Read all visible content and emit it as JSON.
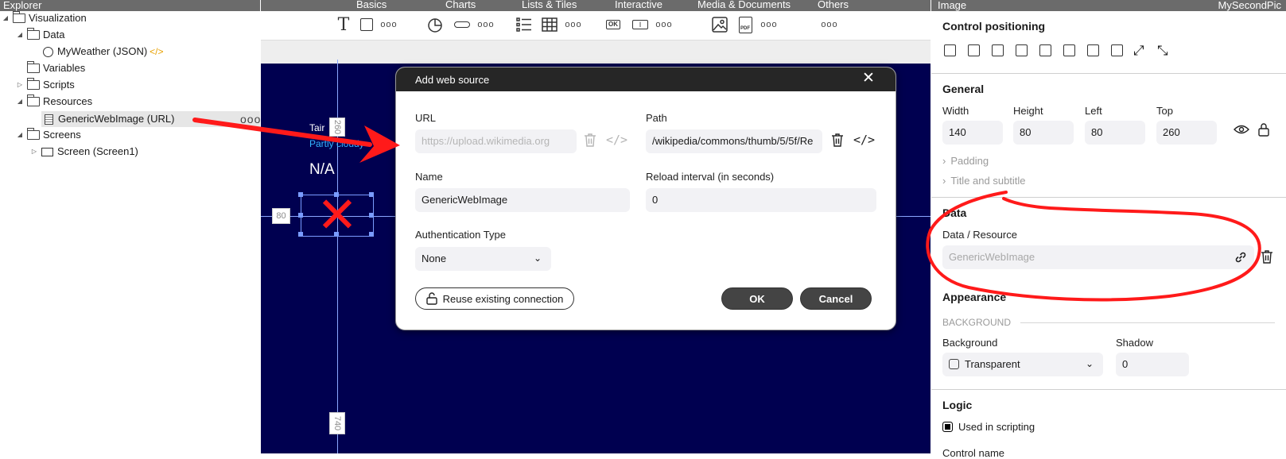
{
  "explorer": {
    "title": "Explorer",
    "items": [
      {
        "label": "Visualization"
      },
      {
        "label": "Data"
      },
      {
        "label": "MyWeather (JSON)",
        "badge": "</>"
      },
      {
        "label": "Variables"
      },
      {
        "label": "Scripts"
      },
      {
        "label": "Resources"
      },
      {
        "label": "GenericWebImage (URL)",
        "more": "ooo"
      },
      {
        "label": "Screens"
      },
      {
        "label": "Screen (Screen1)"
      }
    ]
  },
  "toolbar": {
    "categories": [
      "Basics",
      "Charts",
      "Lists & Tiles",
      "Interactive",
      "Media & Documents",
      "Others"
    ],
    "more": "ooo",
    "text_tool": "T",
    "ok_badge": "OK",
    "input_badge": "I",
    "pdf_badge": "PDF"
  },
  "canvas": {
    "city_text": "Tair",
    "condition_text": "Partly cloudy",
    "temp_text": "N/A",
    "dim_left": "80",
    "dim_top": "260",
    "dim_bottom": "740",
    "image_placeholder": "✕"
  },
  "dialog": {
    "title": "Add web source",
    "url_label": "URL",
    "url_placeholder": "https://upload.wikimedia.org",
    "path_label": "Path",
    "path_value": "/wikipedia/commons/thumb/5/5f/Re",
    "name_label": "Name",
    "name_value": "GenericWebImage",
    "reload_label": "Reload interval (in seconds)",
    "reload_value": "0",
    "auth_label": "Authentication Type",
    "auth_value": "None",
    "reuse_label": "Reuse existing connection",
    "ok_label": "OK",
    "cancel_label": "Cancel"
  },
  "props": {
    "panel_title": "Image",
    "control_name": "MySecondPic",
    "positioning_title": "Control positioning",
    "general_title": "General",
    "width_label": "Width",
    "width_value": "140",
    "height_label": "Height",
    "height_value": "80",
    "left_label": "Left",
    "left_value": "80",
    "top_label": "Top",
    "top_value": "260",
    "padding_label": "Padding",
    "title_subtitle_label": "Title and subtitle",
    "data_title": "Data",
    "data_resource_label": "Data / Resource",
    "data_resource_placeholder": "GenericWebImage",
    "appearance_title": "Appearance",
    "background_section": "BACKGROUND",
    "background_label": "Background",
    "background_value": "Transparent",
    "shadow_label": "Shadow",
    "shadow_value": "0",
    "logic_title": "Logic",
    "used_in_scripting": "Used in scripting",
    "control_name_label": "Control name"
  },
  "colors": {
    "canvas_bg": "#000050",
    "annotation_red": "#ff1a1a",
    "accent_cyan": "#33b5ff"
  }
}
